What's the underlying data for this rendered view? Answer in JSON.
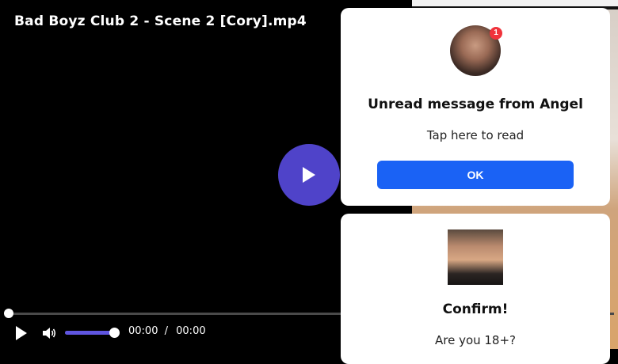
{
  "player": {
    "title": "Bad Boyz Club 2 - Scene 2 [Cory].mp4",
    "current_time": "00:00",
    "separator": "/",
    "duration": "00:00",
    "progress_fraction": 0.0,
    "volume_fraction": 1.0,
    "accent_color": "#4f43c9",
    "play_icon": "play-icon",
    "volume_icon": "volume-icon"
  },
  "notification": {
    "badge_count": "1",
    "title": "Unread message from Angel",
    "subtitle": "Tap here to read",
    "ok_label": "OK",
    "button_color": "#1a62f5",
    "badge_color": "#f0323b"
  },
  "confirm": {
    "title": "Confirm!",
    "question": "Are you 18+?"
  }
}
